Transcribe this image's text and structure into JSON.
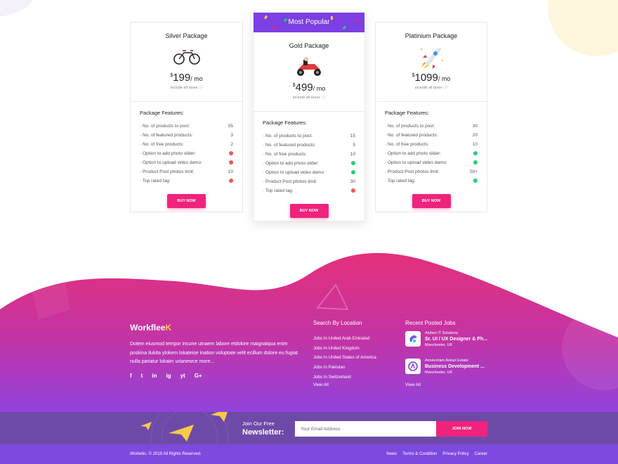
{
  "colors": {
    "accent": "#f0237c",
    "popular": "#7b3fe4",
    "footer_top": "#e0307e",
    "footer_bottom": "#8e44e0",
    "newsletter": "#6e4aa8",
    "bottom_bar": "#7e49de",
    "check": "#2ecc71",
    "cross": "#f2545b"
  },
  "pricing": {
    "popular_label": "Most Popular",
    "features_heading": "Package Features:",
    "buy_label": "BUY NOW",
    "tax_note": "include all taxes",
    "per": "/ mo",
    "currency": "$",
    "plans": [
      {
        "name": "Silver Package",
        "icon": "bicycle-icon",
        "price": "199",
        "features": [
          {
            "label": "No. of products to post:",
            "value": "05"
          },
          {
            "label": "No. of featured products:",
            "value": "3"
          },
          {
            "label": "No. of free products:",
            "value": "2"
          },
          {
            "label": "Option to add photo slider:",
            "value": "no"
          },
          {
            "label": "Option to upload video demo:",
            "value": "no"
          },
          {
            "label": "Product Post photos limit:",
            "value": "10"
          },
          {
            "label": "Top rated tag:",
            "value": "no"
          }
        ]
      },
      {
        "name": "Gold Package",
        "icon": "go-kart-icon",
        "price": "499",
        "features": [
          {
            "label": "No. of products to post:",
            "value": "15"
          },
          {
            "label": "No. of featured products:",
            "value": "5"
          },
          {
            "label": "No. of free products:",
            "value": "10"
          },
          {
            "label": "Option to add photo slider:",
            "value": "yes"
          },
          {
            "label": "Option to upload video demo:",
            "value": "yes"
          },
          {
            "label": "Product Post photos limit:",
            "value": "30"
          },
          {
            "label": "Top rated tag:",
            "value": "no"
          }
        ]
      },
      {
        "name": "Platinium Package",
        "icon": "rocket-icon",
        "price": "1099",
        "features": [
          {
            "label": "No. of products to post:",
            "value": "30"
          },
          {
            "label": "No. of featured products:",
            "value": "20"
          },
          {
            "label": "No. of free products:",
            "value": "10"
          },
          {
            "label": "Option to add photo slider:",
            "value": "yes"
          },
          {
            "label": "Option to upload video demo:",
            "value": "yes"
          },
          {
            "label": "Product Post photos limit:",
            "value": "50+"
          },
          {
            "label": "Top rated tag:",
            "value": "yes"
          }
        ]
      }
    ]
  },
  "footer": {
    "brand_main": "Workflee",
    "brand_k": "K",
    "about": "Dotem eiusmod tempor incune utnaem labore etdolore maignaiqua enim poskina ilukita ylokem lokateise ination voluptate velit ecillum dolore eu fugiat nulla pariatur lokaim urianewce more...",
    "social": [
      "f",
      "t",
      "in",
      "ig",
      "yt",
      "G+"
    ],
    "social_icons": [
      "facebook-icon",
      "twitter-icon",
      "linkedin-icon",
      "instagram-icon",
      "youtube-icon",
      "google-plus-icon"
    ],
    "location_heading": "Search By Location",
    "locations": [
      "Jobs In United Arab Emirated",
      "Jobs In United Kingdom",
      "Jobs In United States of America",
      "Jobs In Pakistan",
      "Jobs In Switzerland"
    ],
    "locations_view_all": "View All",
    "jobs_heading": "Recent Posted Jobs",
    "jobs": [
      {
        "company": "Alobex IT Solutions",
        "title": "Sr. UI / UX Designer & Ph...",
        "location": "Manchester, UK"
      },
      {
        "company": "Amsterdam Askari Estate",
        "title": "Business Development ...",
        "location": "Manchester, UK"
      }
    ],
    "jobs_view_all": "View All"
  },
  "newsletter": {
    "label_top": "Join Our Free",
    "label_main": "Newsletter:",
    "placeholder": "Your Email Address",
    "button": "JOIN NOW"
  },
  "bottom": {
    "copyright": "Worketic. © 2019 All Rights Reserved.",
    "links": [
      "News",
      "Terms & Condition",
      "Privacy Policy",
      "Career"
    ]
  }
}
